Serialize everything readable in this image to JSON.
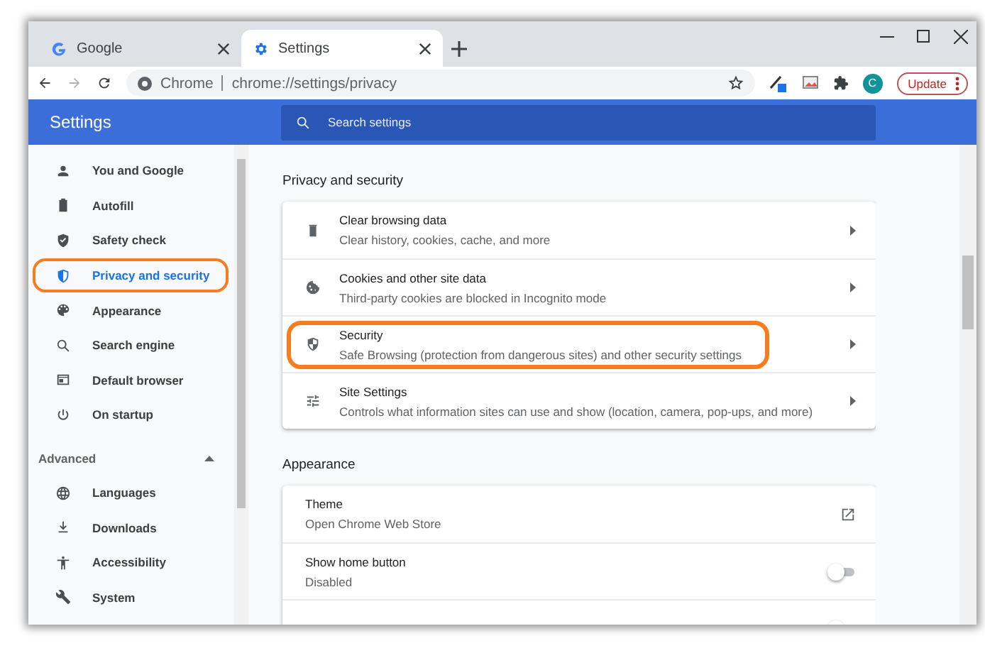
{
  "tabs": [
    {
      "title": "Google",
      "selected": false
    },
    {
      "title": "Settings",
      "selected": true
    }
  ],
  "address_bar": {
    "site_label": "Chrome",
    "url": "chrome://settings/privacy"
  },
  "toolbar": {
    "avatar_letter": "C",
    "update_button": "Update"
  },
  "header": {
    "title": "Settings",
    "search": {
      "placeholder": "Search settings"
    }
  },
  "sidebar": {
    "items": [
      {
        "label": "You and Google",
        "selected": false,
        "highlighted": false
      },
      {
        "label": "Autofill",
        "selected": false,
        "highlighted": false
      },
      {
        "label": "Safety check",
        "selected": false,
        "highlighted": false
      },
      {
        "label": "Privacy and security",
        "selected": true,
        "highlighted": true
      },
      {
        "label": "Appearance",
        "selected": false,
        "highlighted": false
      },
      {
        "label": "Search engine",
        "selected": false,
        "highlighted": false
      },
      {
        "label": "Default browser",
        "selected": false,
        "highlighted": false
      },
      {
        "label": "On startup",
        "selected": false,
        "highlighted": false
      }
    ],
    "advanced": {
      "label": "Advanced",
      "expanded": true,
      "items": [
        {
          "label": "Languages",
          "selected": false
        },
        {
          "label": "Downloads",
          "selected": false
        },
        {
          "label": "Accessibility",
          "selected": false
        },
        {
          "label": "System",
          "selected": false
        }
      ]
    }
  },
  "sections": [
    {
      "title": "Privacy and security",
      "rows": [
        {
          "kind": "link",
          "title": "Clear browsing data",
          "subtitle": "Clear history, cookies, cache, and more",
          "highlighted": false
        },
        {
          "kind": "link",
          "title": "Cookies and other site data",
          "subtitle": "Third-party cookies are blocked in Incognito mode",
          "highlighted": false
        },
        {
          "kind": "link",
          "title": "Security",
          "subtitle": "Safe Browsing (protection from dangerous sites) and other security settings",
          "highlighted": true
        },
        {
          "kind": "link",
          "title": "Site Settings",
          "subtitle": "Controls what information sites can use and show (location, camera, pop-ups, and more)",
          "highlighted": false
        }
      ]
    },
    {
      "title": "Appearance",
      "rows": [
        {
          "kind": "external",
          "title": "Theme",
          "subtitle": "Open Chrome Web Store",
          "highlighted": false
        },
        {
          "kind": "toggle",
          "title": "Show home button",
          "subtitle": "Disabled",
          "on": false,
          "highlighted": false
        },
        {
          "kind": "toggle",
          "on": false,
          "highlighted": false
        }
      ]
    }
  ]
}
